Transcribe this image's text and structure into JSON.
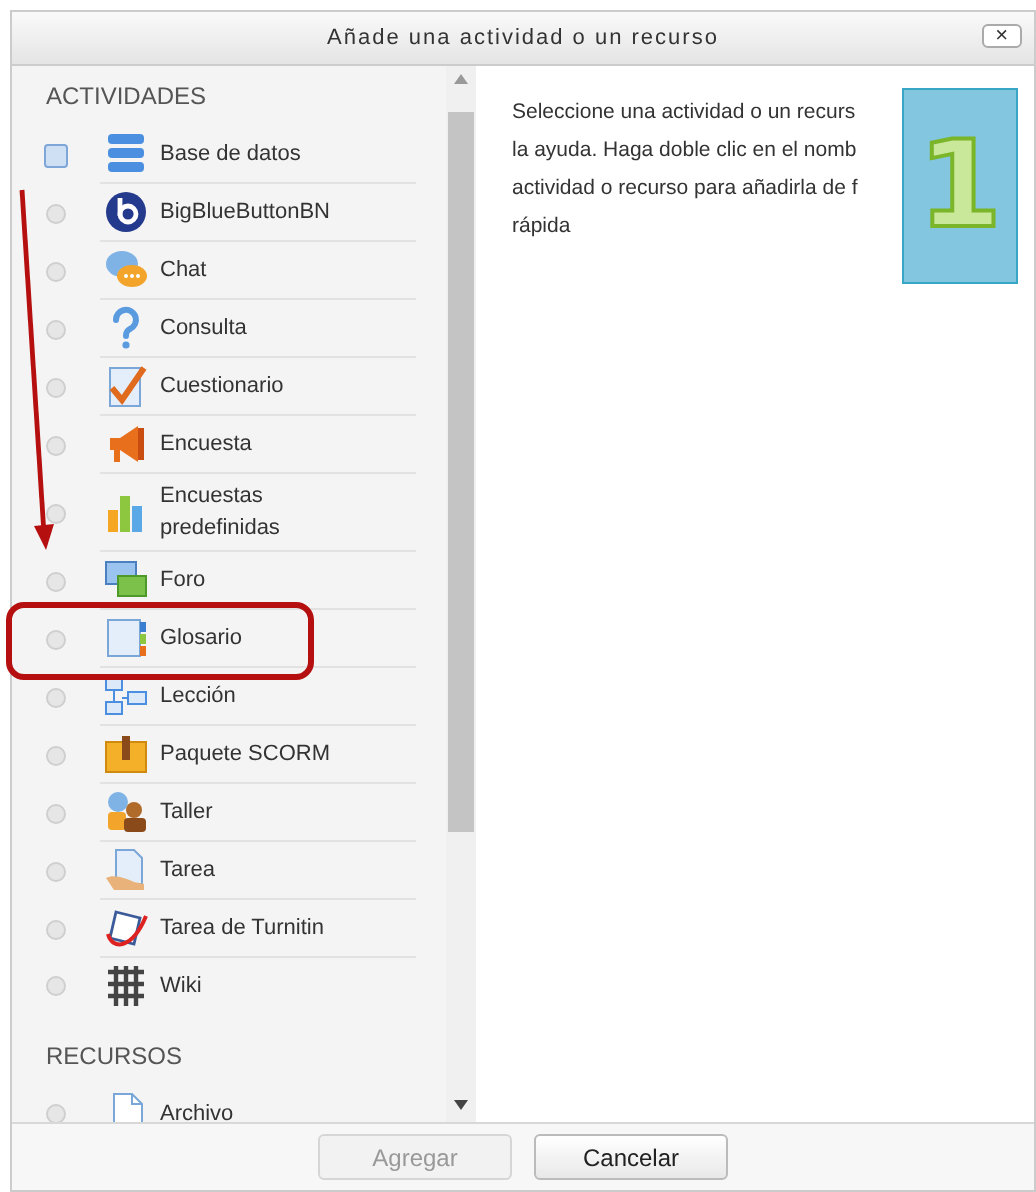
{
  "dialog": {
    "title": "Añade una actividad o un recurso",
    "close": "×"
  },
  "sections": [
    {
      "heading": "ACTIVIDADES",
      "items": [
        {
          "name": "Base de datos",
          "selected": true
        },
        {
          "name": "BigBlueButtonBN",
          "selected": false
        },
        {
          "name": "Chat",
          "selected": false
        },
        {
          "name": "Consulta",
          "selected": false
        },
        {
          "name": "Cuestionario",
          "selected": false
        },
        {
          "name": "Encuesta",
          "selected": false
        },
        {
          "name": "Encuestas predefinidas",
          "selected": false
        },
        {
          "name": "Foro",
          "selected": false
        },
        {
          "name": "Glosario",
          "selected": false
        },
        {
          "name": "Lección",
          "selected": false
        },
        {
          "name": "Paquete SCORM",
          "selected": false
        },
        {
          "name": "Taller",
          "selected": false
        },
        {
          "name": "Tarea",
          "selected": false
        },
        {
          "name": "Tarea de Turnitin",
          "selected": false
        },
        {
          "name": "Wiki",
          "selected": false
        }
      ]
    },
    {
      "heading": "RECURSOS",
      "items": [
        {
          "name": "Archivo",
          "selected": false
        }
      ]
    }
  ],
  "help_lines": [
    "Seleccione una actividad o un recurs",
    "la ayuda. Haga doble clic en el nomb",
    "actividad o recurso para añadirla de f",
    "rápida"
  ],
  "badge": "1",
  "buttons": [
    {
      "label": "Agregar",
      "disabled": true
    },
    {
      "label": "Cancelar",
      "disabled": false
    }
  ]
}
